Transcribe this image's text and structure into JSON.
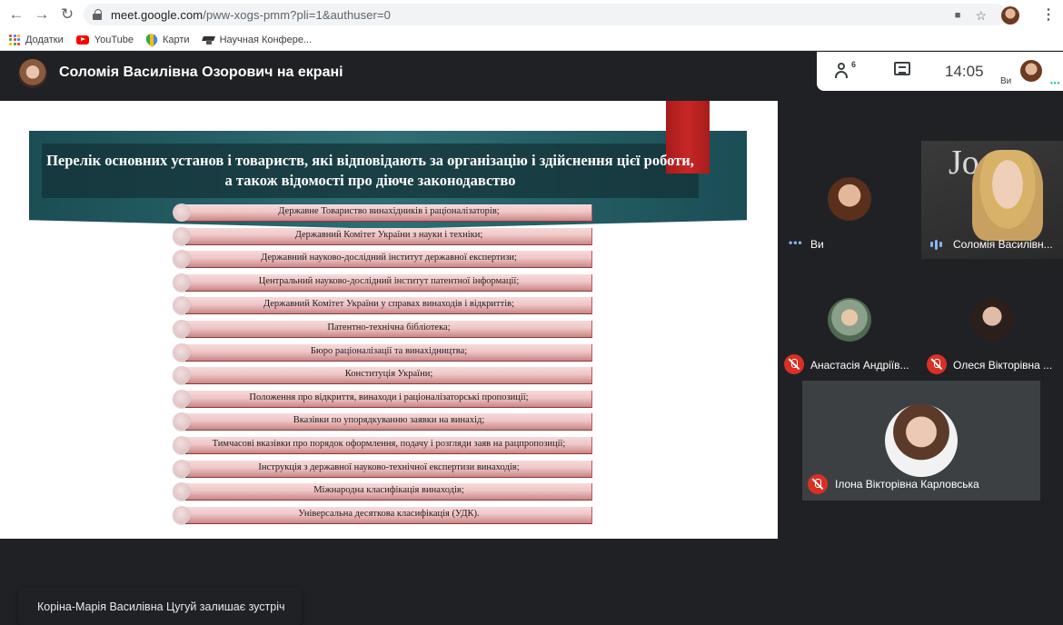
{
  "browser": {
    "url_main": "meet.google.com",
    "url_path": "/pww-xogs-pmm?pli=1&authuser=0",
    "bookmarks": [
      {
        "label": "Додатки",
        "icon": "apps-icon"
      },
      {
        "label": "YouTube",
        "icon": "youtube-icon"
      },
      {
        "label": "Карти",
        "icon": "maps-icon"
      },
      {
        "label": "Научная Конфере...",
        "icon": "graduation-cap-icon"
      }
    ]
  },
  "meeting": {
    "presenter_title": "Соломія Василівна Озорович на екрані",
    "participant_count": "6",
    "time": "14:05",
    "self_label": "Ви",
    "accent_color": "#00bfa5",
    "mute_color": "#d93025"
  },
  "slide": {
    "title": "Перелік основних установ і товариств, які відповідають за організацію і здійснення цієї роботи, а також відомості про діюче законодавство",
    "items": [
      "Державне Товариство винахідників і раціоналізаторів;",
      "Державний Комітет України з науки і техніки;",
      "Державний науково-дослідний інститут державної експертизи;",
      "Центральний науково-дослідний інститут патентної інформації;",
      "Державний Комітет України у справах винаходів і відкриттів;",
      "Патентно-технічна бібліотека;",
      "Бюро раціоналізації та винахідництва;",
      "Конституція України;",
      "Положення про відкриття, винаходи і раціоналізаторські пропозиції;",
      "Вказівки по упорядкуванню заявки на винахід;",
      "Тимчасові вказівки про порядок оформлення, подачу і розгляди заяв на рацпропозиції;",
      "Інструкція з державної науково-технічної експертизи винаходів;",
      "Міжнародна класифікація винаходів;",
      "Універсальна десяткова класифікація (УДК)."
    ]
  },
  "toast": {
    "text": "Коріна-Марія Василівна Цугуй залишає зустріч"
  },
  "participants": [
    {
      "name": "Ви",
      "status": "speaking-indicator"
    },
    {
      "name": "Соломія Василівн...",
      "status": "audio-active"
    },
    {
      "name": "Анастасія Андріїв...",
      "status": "muted"
    },
    {
      "name": "Олеся Вікторівна ...",
      "status": "muted"
    },
    {
      "name": "Ілона Вікторівна Карловська",
      "status": "muted"
    }
  ]
}
